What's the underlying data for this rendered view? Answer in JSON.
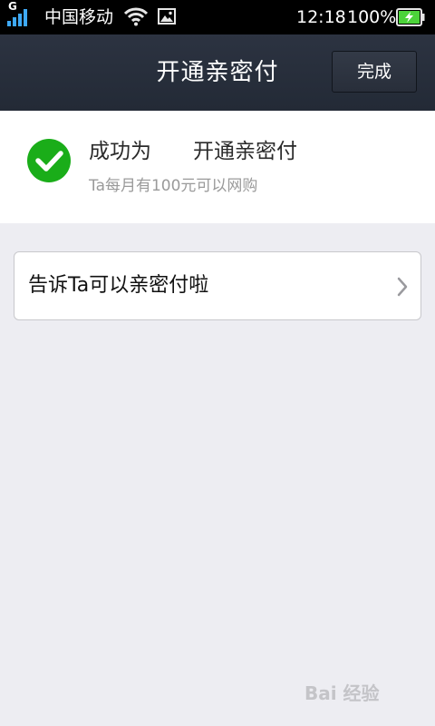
{
  "status_bar": {
    "network_type": "G",
    "carrier": "中国移动",
    "time": "12:18",
    "battery_percent": "100%",
    "icons": [
      "signal-icon",
      "wifi-icon",
      "gallery-icon",
      "battery-charging-icon"
    ]
  },
  "title_bar": {
    "title": "开通亲密付",
    "done_label": "完成"
  },
  "success": {
    "title_before": "成功为",
    "title_masked": "　　",
    "title_after": "开通亲密付",
    "subtitle": "Ta每月有100元可以网购",
    "icon": "check-circle-icon",
    "icon_color": "#1aad19"
  },
  "tell": {
    "label": "告诉Ta可以亲密付啦",
    "icon": "chevron-right-icon"
  },
  "watermark": {
    "text": "Bai 经验"
  },
  "colors": {
    "background": "#ededf2",
    "title_bar": "#272e3a",
    "accent_green": "#1aad19",
    "battery_green": "#4cd33a"
  }
}
